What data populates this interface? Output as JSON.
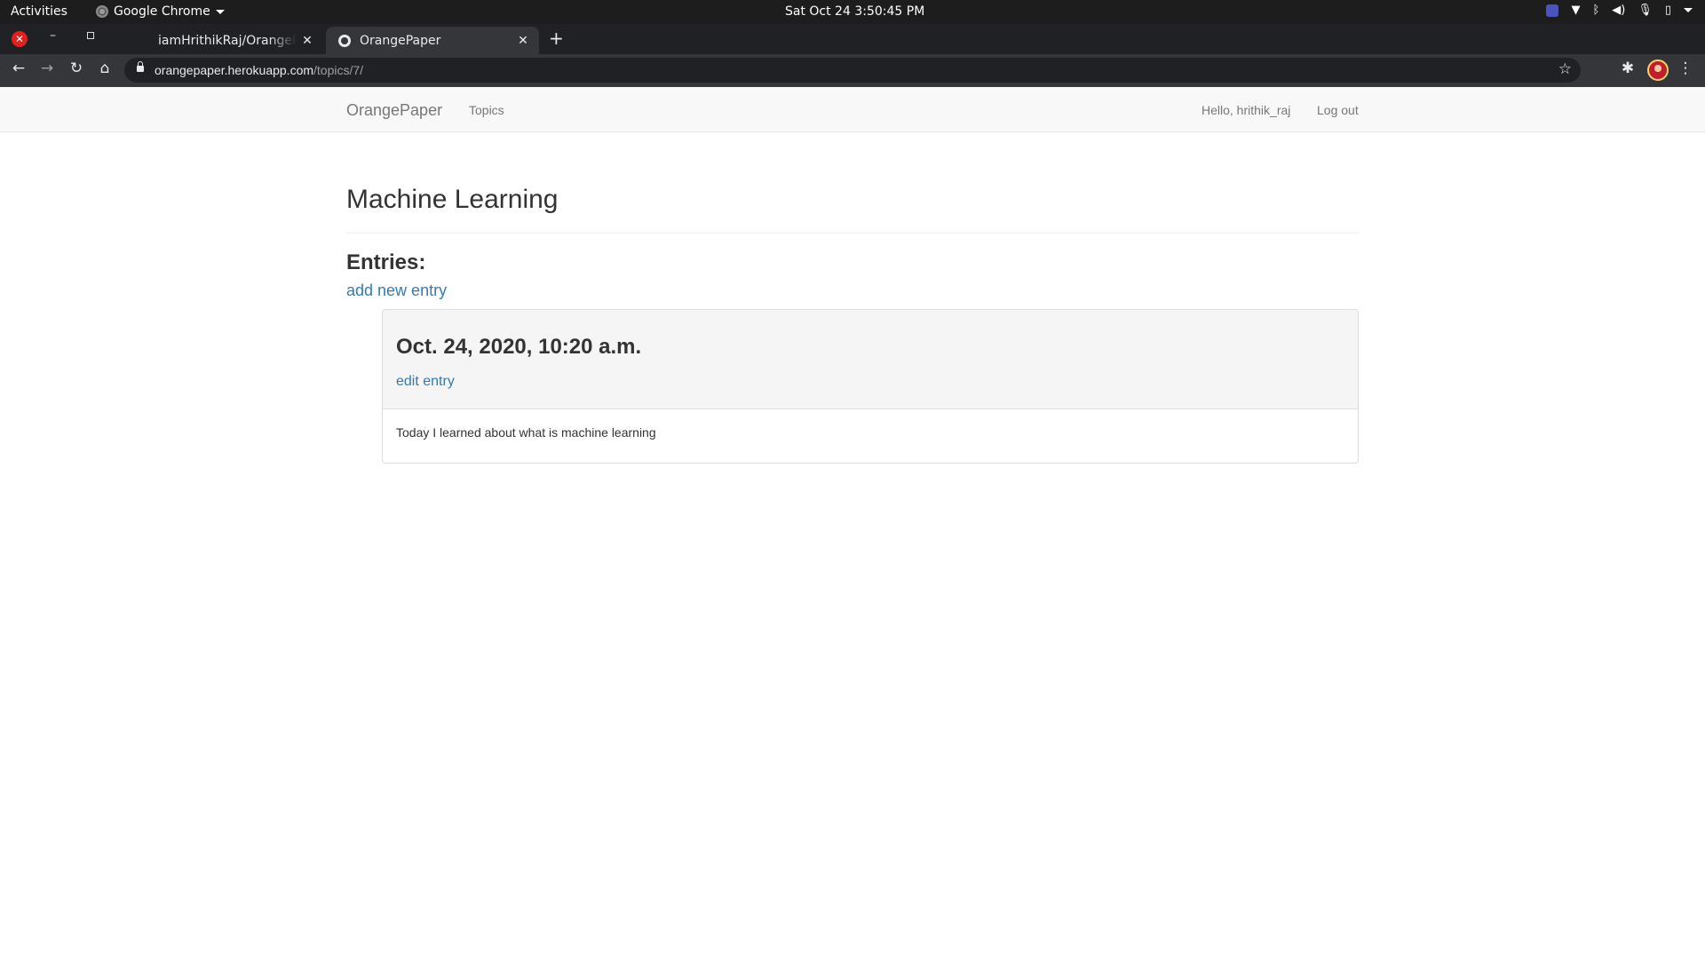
{
  "system_bar": {
    "activities": "Activities",
    "app_name": "Google Chrome",
    "clock": "Sat Oct 24  3:50:45 PM"
  },
  "browser": {
    "tabs": [
      {
        "title": "iamHrithikRaj/OrangePaper",
        "active": false
      },
      {
        "title": "OrangePaper",
        "active": true
      }
    ],
    "address": {
      "host": "orangepaper.herokuapp.com",
      "path": "/topics/7/"
    }
  },
  "navbar": {
    "brand": "OrangePaper",
    "topics_link": "Topics",
    "greeting": "Hello, hrithik_raj",
    "logout_link": "Log out"
  },
  "topic": {
    "title": "Machine Learning",
    "entries_heading": "Entries:",
    "add_entry_link": "add new entry",
    "entries": [
      {
        "date": "Oct. 24, 2020, 10:20 a.m.",
        "edit_link": "edit entry",
        "text": "Today I learned about what is machine learning"
      }
    ]
  },
  "colors": {
    "link": "#337ab7",
    "navbar_bg": "#f8f8f8",
    "panel_heading_bg": "#f5f5f5",
    "chrome_dark": "#202124",
    "close_red": "#e0201c"
  }
}
